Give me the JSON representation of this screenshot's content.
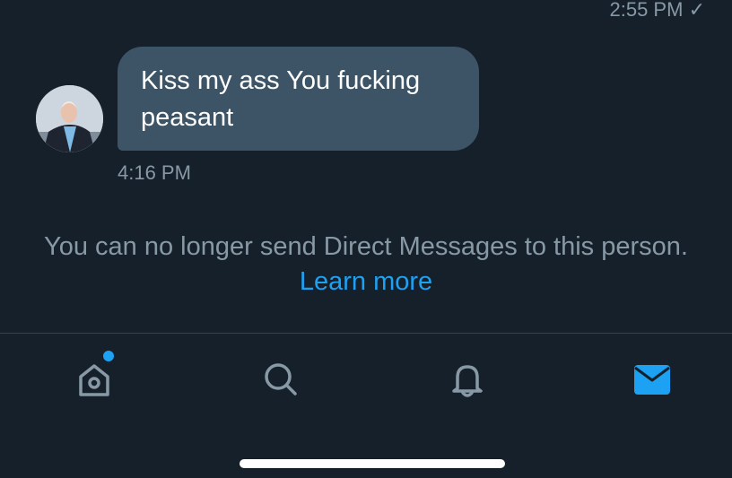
{
  "previous_message": {
    "timestamp": "2:55 PM",
    "read_receipt": "✓"
  },
  "message": {
    "text": "Kiss my ass You fucking peasant",
    "timestamp": "4:16 PM"
  },
  "notice": {
    "text": "You can no longer send Direct Messages to this person.",
    "link_text": "Learn more"
  },
  "tab_bar": {
    "items": [
      {
        "name": "home",
        "icon": "home-icon",
        "active": false,
        "has_notification_dot": true
      },
      {
        "name": "search",
        "icon": "search-icon",
        "active": false
      },
      {
        "name": "notifications",
        "icon": "bell-icon",
        "active": false
      },
      {
        "name": "messages",
        "icon": "mail-icon",
        "active": true
      }
    ]
  },
  "colors": {
    "background": "#15202b",
    "bubble": "#3d5466",
    "muted_text": "#8899a6",
    "accent": "#1da1f2",
    "divider": "#38444d"
  }
}
